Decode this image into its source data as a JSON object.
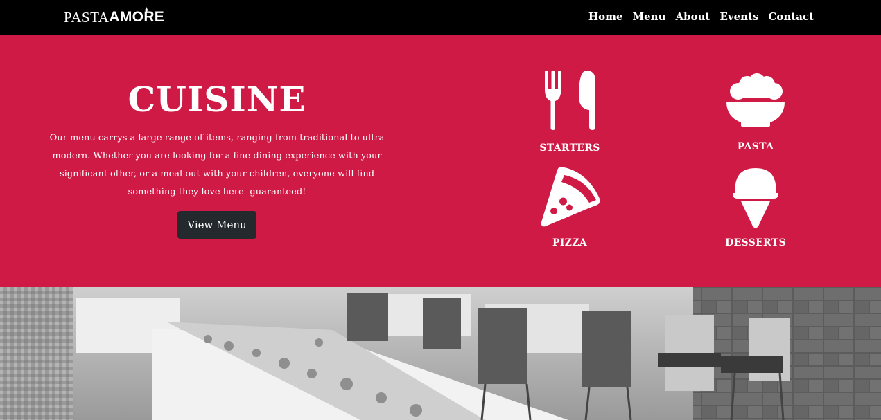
{
  "brand": {
    "part1": "PASTA",
    "part2": "AMORE"
  },
  "nav": {
    "items": [
      {
        "label": "Home"
      },
      {
        "label": "Menu"
      },
      {
        "label": "About"
      },
      {
        "label": "Events"
      },
      {
        "label": "Contact"
      }
    ]
  },
  "hero": {
    "title": "CUISINE",
    "description": "Our menu carrys a large range of items, ranging from traditional to ultra modern. Whether you are looking for a fine dining experience with your significant other, or a meal out with your children, everyone will find something they love here--guaranteed!",
    "button_label": "View Menu"
  },
  "categories": [
    {
      "label": "STARTERS",
      "icon": "fork-knife-icon"
    },
    {
      "label": "PASTA",
      "icon": "pasta-bowl-icon"
    },
    {
      "label": "PIZZA",
      "icon": "pizza-slice-icon"
    },
    {
      "label": "DESSERTS",
      "icon": "ice-cream-cone-icon"
    }
  ],
  "colors": {
    "navbar": "#000000",
    "hero_background": "#cf1a45",
    "button_background": "#24292d",
    "text": "#ffffff"
  }
}
